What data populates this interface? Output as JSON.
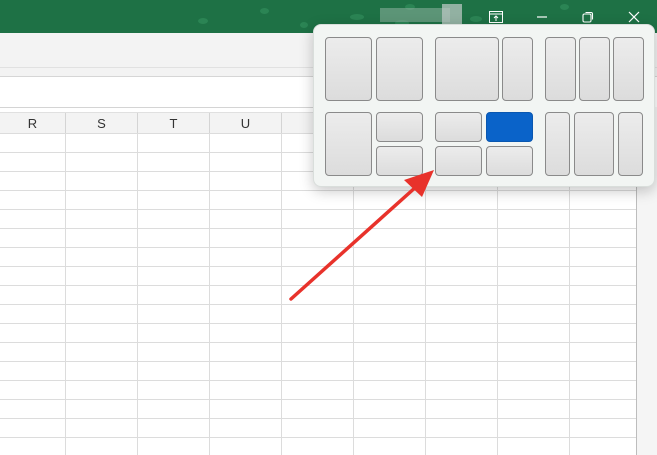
{
  "titlebar": {
    "background": "#1e7145",
    "buttons": [
      "snap-layout-icon",
      "minimize-icon",
      "restore-icon",
      "close-icon"
    ]
  },
  "sheet": {
    "columns": [
      "R",
      "S",
      "T",
      "U"
    ],
    "gridline_color": "#dcdcdc"
  },
  "snap_flyout": {
    "layouts": [
      {
        "name": "two-equal-columns",
        "zones": 2
      },
      {
        "name": "two-columns-wide-left",
        "zones": 2
      },
      {
        "name": "three-equal-columns",
        "zones": 3
      },
      {
        "name": "left-column-with-right-split",
        "zones": 3
      },
      {
        "name": "four-quadrants",
        "zones": 4,
        "selected_zone": "top-right"
      },
      {
        "name": "three-columns-wide-center",
        "zones": 3
      }
    ],
    "selected_color": "#0a63c9"
  },
  "annotation": {
    "arrow_color": "#e8322b",
    "points_to": "four-quadrants-layout"
  }
}
